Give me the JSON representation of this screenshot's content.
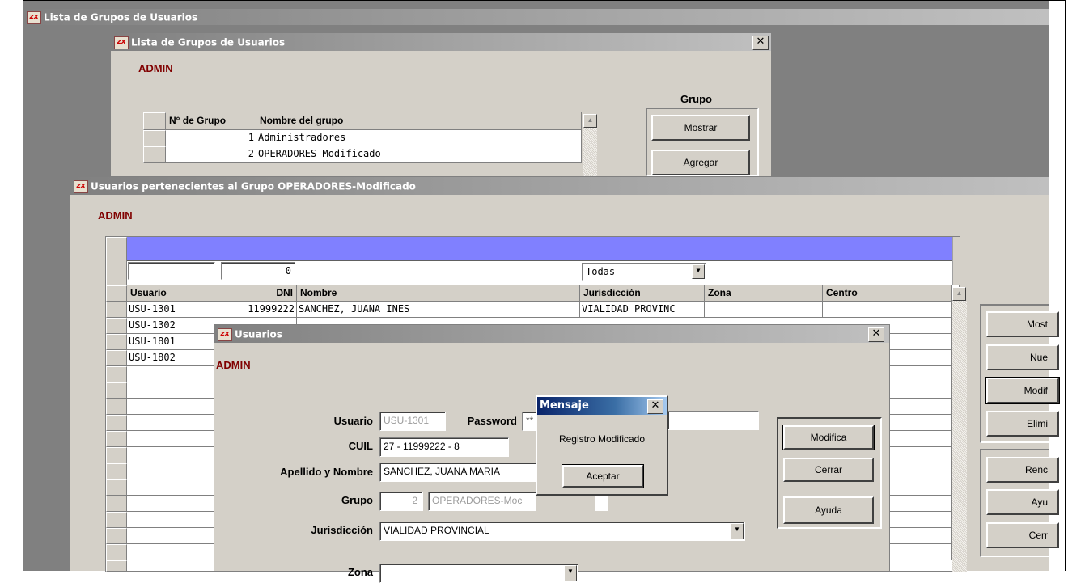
{
  "outer_window": {
    "title": "Lista de Grupos de Usuarios"
  },
  "groups_window": {
    "title": "Lista de Grupos de Usuarios",
    "user_label": "ADMIN",
    "group_section_label": "Grupo",
    "columns": [
      "N° de Grupo",
      "Nombre del grupo"
    ],
    "rows": [
      {
        "num": "1",
        "name": "Administradores"
      },
      {
        "num": "2",
        "name": "OPERADORES-Modificado"
      }
    ],
    "buttons": {
      "show": "Mostrar",
      "add": "Agregar"
    },
    "close": "✕"
  },
  "members_window": {
    "title": "Usuarios pertenecientes al Grupo OPERADORES-Modificado",
    "user_label": "ADMIN",
    "filters": {
      "usuario": "",
      "dni": "0",
      "jurisdiccion": "Todas"
    },
    "columns": [
      "Usuario",
      "DNI",
      "Nombre",
      "Jurisdicción",
      "Zona",
      "Centro"
    ],
    "rows": [
      {
        "usuario": "USU-1301",
        "dni": "11999222",
        "nombre": "SANCHEZ, JUANA INES",
        "jurisdiccion": "VIALIDAD PROVINC",
        "zona": "",
        "centro": ""
      },
      {
        "usuario": "USU-1302",
        "dni": "",
        "nombre": "",
        "jurisdiccion": "",
        "zona": "",
        "centro": ""
      },
      {
        "usuario": "USU-1801",
        "dni": "",
        "nombre": "",
        "jurisdiccion": "",
        "zona": "",
        "centro": ""
      },
      {
        "usuario": "USU-1802",
        "dni": "",
        "nombre": "",
        "jurisdiccion": "",
        "zona": "",
        "centro": ""
      }
    ],
    "side_buttons": [
      "Most",
      "Nue",
      "Modif",
      "Elimi",
      "Renc",
      "Ayu",
      "Cerr"
    ]
  },
  "user_window": {
    "title": "Usuarios",
    "user_label": "ADMIN",
    "labels": {
      "usuario": "Usuario",
      "password": "Password",
      "cuil": "CUIL",
      "apellido_nombre": "Apellido y Nombre",
      "grupo": "Grupo",
      "jurisdiccion": "Jurisdicción",
      "zona": "Zona"
    },
    "values": {
      "usuario": "USU-1301",
      "password": "**",
      "cuil": "27 - 11999222 - 8",
      "apellido_nombre": "SANCHEZ, JUANA MARIA",
      "grupo_num": "2",
      "grupo_name": "OPERADORES-Moc",
      "jurisdiccion": "VIALIDAD PROVINCIAL"
    },
    "buttons": {
      "modifica": "Modifica",
      "cerrar": "Cerrar",
      "ayuda": "Ayuda"
    }
  },
  "message_dialog": {
    "title": "Mensaje",
    "text": "Registro Modificado",
    "ok": "Aceptar"
  }
}
